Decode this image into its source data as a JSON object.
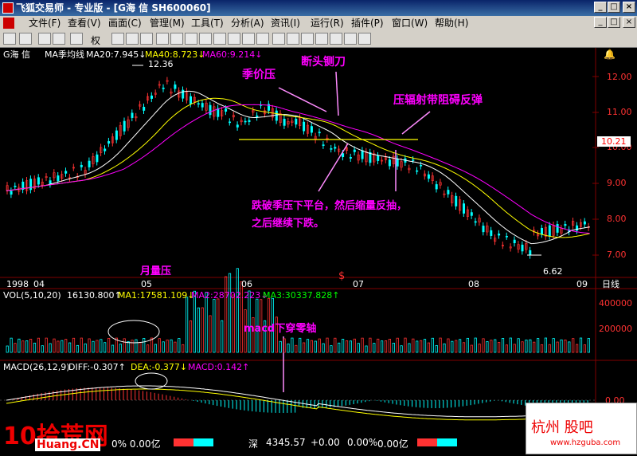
{
  "window": {
    "title": "飞狐交易师 - 专业版 - [G海  信 SH600060]",
    "min_label": "_",
    "max_label": "□",
    "close_label": "×",
    "child_min": "_",
    "child_max": "□",
    "child_close": "×"
  },
  "menu": [
    "文件(F)",
    "查看(V)",
    "画面(C)",
    "管理(M)",
    "工具(T)",
    "分析(A)",
    "资讯(I)",
    "运行(R)",
    "插件(P)",
    "窗口(W)",
    "帮助(H)"
  ],
  "toolbar": {
    "right_label": "权"
  },
  "price_header": {
    "name": "G海  信",
    "indicator": "MA季均线",
    "ma20": "MA20:7.945↓",
    "ma40": "MA40:8.723↓",
    "ma60": "MA60:9.214↓"
  },
  "price_axis": [
    "12.00",
    "11.00",
    "10.00",
    "9.00",
    "8.00",
    "7.00"
  ],
  "current_price": "10.21",
  "high_label": "12.36",
  "low_label": "6.62",
  "time_axis": [
    "1998",
    "04",
    "05",
    "06",
    "07",
    "08",
    "09"
  ],
  "period_label": "日线",
  "annotations": {
    "season_pressure": "季价压",
    "guillotine": "断头铡刀",
    "radiation_band": "压辐射带阻碍反弹",
    "break_text_1": "跌破季压下平台，然后缩量反抽，",
    "break_text_2": "之后继续下跌。",
    "monthly_volume": "月量压",
    "macd_cross": "macd下穿零轴"
  },
  "vol_header": {
    "label": "VOL(5,10,20)",
    "value": "16130.800↑",
    "ma1": "MA1:17581.109↓",
    "ma2": "MA2:28702.223↓",
    "ma3": "MA3:30337.828↑"
  },
  "vol_axis": [
    "400000",
    "200000"
  ],
  "macd_header": {
    "label": "MACD(26,12,9)",
    "diff": "DIFF:-0.307↑",
    "dea": "DEA:-0.377↓",
    "macd": "MACD:0.142↑"
  },
  "macd_axis": [
    "0.00"
  ],
  "status": {
    "left": "0%  0.00亿",
    "index_name": "深",
    "index_value": "4345.57",
    "change": "+0.00",
    "pct": "0.00%",
    "amount": "0.00亿"
  },
  "watermarks": {
    "left": "10拾荒网",
    "left_sub": "Huang.CN",
    "right": "杭州  股吧",
    "right_sub": "www.hzguba.com"
  },
  "colors": {
    "up": "#ff3232",
    "down": "#00ffff",
    "ma20": "#ffffff",
    "ma40": "#ffff00",
    "ma60": "#ff00ff",
    "annotation": "#ff00ff"
  }
}
